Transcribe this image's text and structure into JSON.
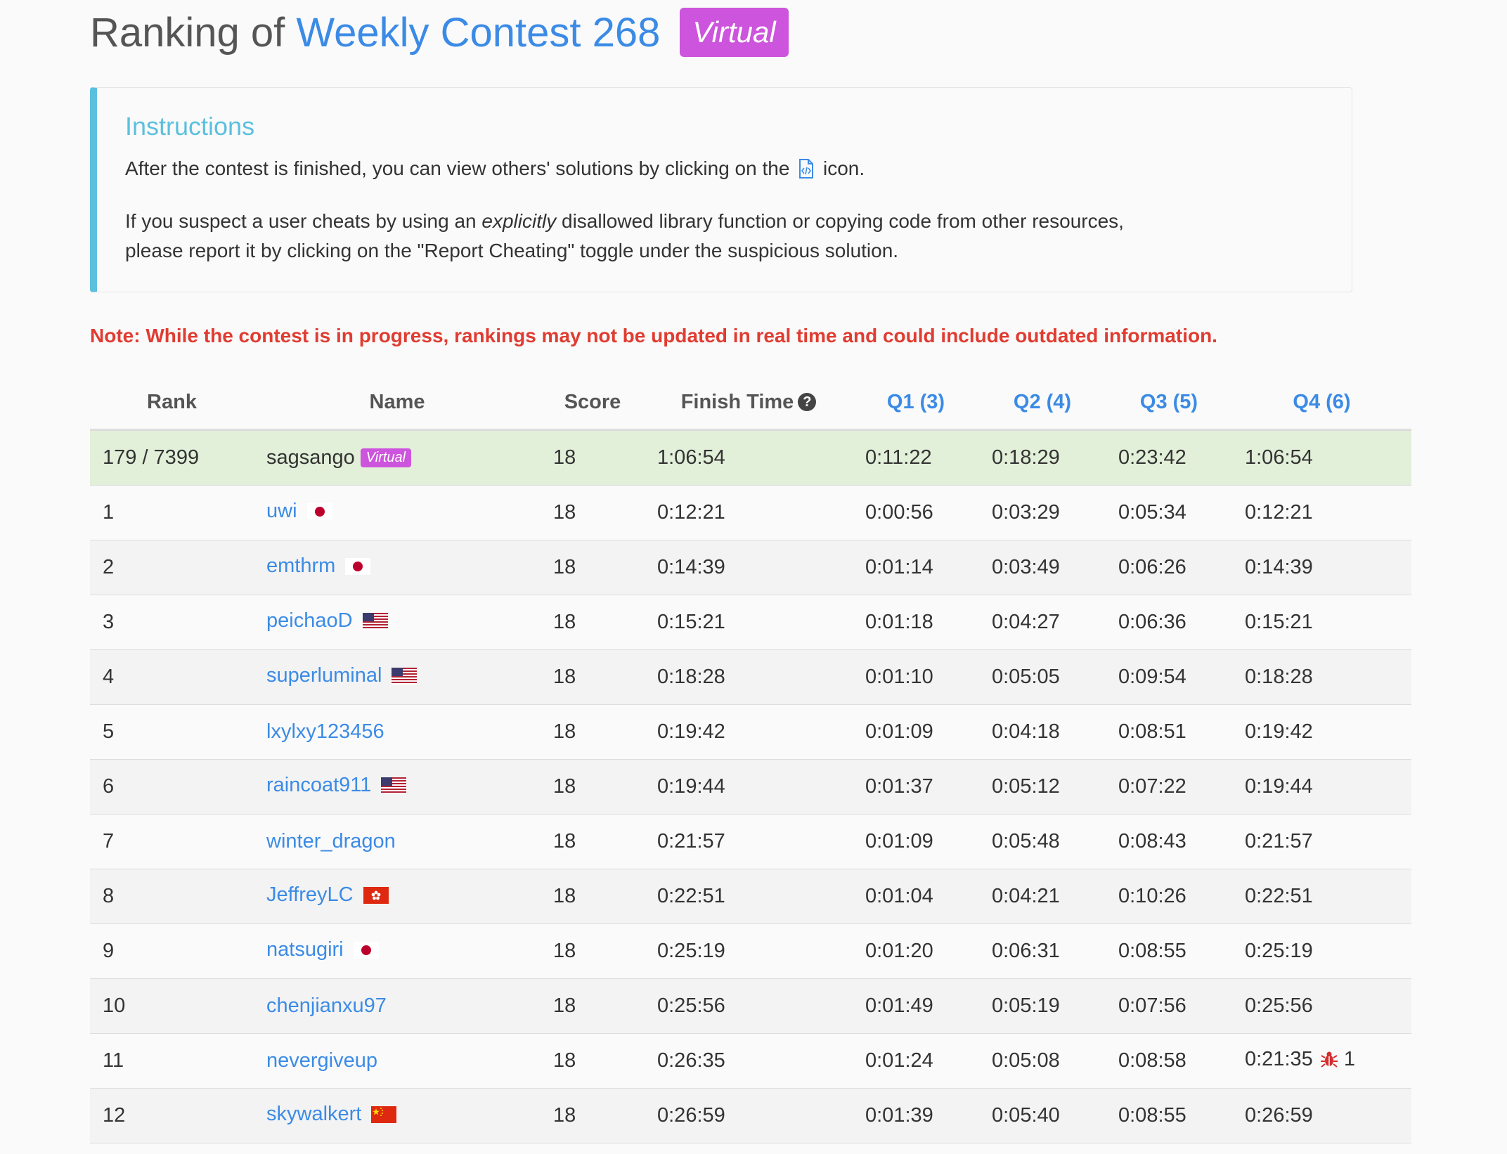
{
  "title": {
    "prefix": "Ranking of ",
    "contest": "Weekly Contest 268",
    "badge": "Virtual"
  },
  "instructions": {
    "heading": "Instructions",
    "line1_before": "After the contest is finished, you can view others' solutions by clicking on the ",
    "line1_after": " icon.",
    "line2_before": "If you suspect a user cheats by using an ",
    "line2_emph": "explicitly",
    "line2_after": " disallowed library function or copying code from other resources,",
    "line3": "please report it by clicking on the \"Report Cheating\" toggle under the suspicious solution."
  },
  "note": "Note: While the contest is in progress, rankings may not be updated in real time and could include outdated information.",
  "table": {
    "headers": {
      "rank": "Rank",
      "name": "Name",
      "score": "Score",
      "finish": "Finish Time",
      "q1": "Q1 (3)",
      "q2": "Q2 (4)",
      "q3": "Q3 (5)",
      "q4": "Q4 (6)"
    },
    "me": {
      "rank": "179 / 7399",
      "name": "sagsango",
      "badge": "Virtual",
      "score": "18",
      "finish": "1:06:54",
      "q1": "0:11:22",
      "q2": "0:18:29",
      "q3": "0:23:42",
      "q4": "1:06:54"
    },
    "rows": [
      {
        "rank": "1",
        "name": "uwi",
        "flag": "jp",
        "score": "18",
        "finish": "0:12:21",
        "q1": "0:00:56",
        "q2": "0:03:29",
        "q3": "0:05:34",
        "q4": "0:12:21"
      },
      {
        "rank": "2",
        "name": "emthrm",
        "flag": "jp",
        "score": "18",
        "finish": "0:14:39",
        "q1": "0:01:14",
        "q2": "0:03:49",
        "q3": "0:06:26",
        "q4": "0:14:39"
      },
      {
        "rank": "3",
        "name": "peichaoD",
        "flag": "us",
        "score": "18",
        "finish": "0:15:21",
        "q1": "0:01:18",
        "q2": "0:04:27",
        "q3": "0:06:36",
        "q4": "0:15:21"
      },
      {
        "rank": "4",
        "name": "superluminal",
        "flag": "us",
        "score": "18",
        "finish": "0:18:28",
        "q1": "0:01:10",
        "q2": "0:05:05",
        "q3": "0:09:54",
        "q4": "0:18:28"
      },
      {
        "rank": "5",
        "name": "lxylxy123456",
        "flag": "",
        "score": "18",
        "finish": "0:19:42",
        "q1": "0:01:09",
        "q2": "0:04:18",
        "q3": "0:08:51",
        "q4": "0:19:42"
      },
      {
        "rank": "6",
        "name": "raincoat911",
        "flag": "us",
        "score": "18",
        "finish": "0:19:44",
        "q1": "0:01:37",
        "q2": "0:05:12",
        "q3": "0:07:22",
        "q4": "0:19:44"
      },
      {
        "rank": "7",
        "name": "winter_dragon",
        "flag": "",
        "score": "18",
        "finish": "0:21:57",
        "q1": "0:01:09",
        "q2": "0:05:48",
        "q3": "0:08:43",
        "q4": "0:21:57"
      },
      {
        "rank": "8",
        "name": "JeffreyLC",
        "flag": "hk",
        "score": "18",
        "finish": "0:22:51",
        "q1": "0:01:04",
        "q2": "0:04:21",
        "q3": "0:10:26",
        "q4": "0:22:51"
      },
      {
        "rank": "9",
        "name": "natsugiri",
        "flag": "jp",
        "score": "18",
        "finish": "0:25:19",
        "q1": "0:01:20",
        "q2": "0:06:31",
        "q3": "0:08:55",
        "q4": "0:25:19"
      },
      {
        "rank": "10",
        "name": "chenjianxu97",
        "flag": "",
        "score": "18",
        "finish": "0:25:56",
        "q1": "0:01:49",
        "q2": "0:05:19",
        "q3": "0:07:56",
        "q4": "0:25:56"
      },
      {
        "rank": "11",
        "name": "nevergiveup",
        "flag": "",
        "score": "18",
        "finish": "0:26:35",
        "q1": "0:01:24",
        "q2": "0:05:08",
        "q3": "0:08:58",
        "q4": "0:21:35",
        "bugs": "1"
      },
      {
        "rank": "12",
        "name": "skywalkert",
        "flag": "cn",
        "score": "18",
        "finish": "0:26:59",
        "q1": "0:01:39",
        "q2": "0:05:40",
        "q3": "0:08:55",
        "q4": "0:26:59"
      }
    ]
  },
  "colors": {
    "accent": "#3b8be6",
    "virtual_badge": "#cd54dc",
    "instructions_border": "#5bc0de",
    "note": "#e03c31",
    "current_user_row": "#e2efd9"
  },
  "icons": {
    "solution": "code-file-icon",
    "help": "question-circle-icon",
    "wrong_submission": "bug-icon"
  }
}
